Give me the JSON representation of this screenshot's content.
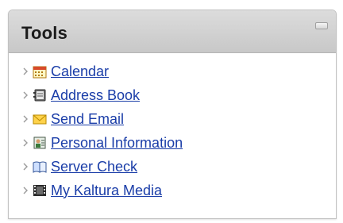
{
  "panel": {
    "title": "Tools"
  },
  "tools": {
    "items": [
      {
        "label": "Calendar",
        "icon": "calendar-icon"
      },
      {
        "label": "Address Book",
        "icon": "address-book-icon"
      },
      {
        "label": "Send Email",
        "icon": "envelope-icon"
      },
      {
        "label": "Personal Information",
        "icon": "personal-information-icon"
      },
      {
        "label": "Server Check",
        "icon": "book-icon"
      },
      {
        "label": "My Kaltura Media",
        "icon": "film-icon"
      }
    ]
  },
  "colors": {
    "link": "#1a3da8",
    "header": "#d0d0d0"
  }
}
